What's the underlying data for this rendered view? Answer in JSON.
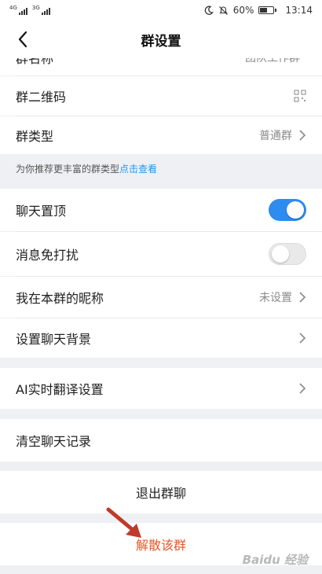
{
  "status_bar": {
    "sim1": "4G",
    "sim2": "3G",
    "battery": "60%",
    "battery_level": 0.6,
    "time": "13:14",
    "icons": [
      "signal-icon",
      "moon-icon",
      "mute-bell-icon",
      "battery-icon"
    ]
  },
  "nav": {
    "title": "群设置",
    "back_icon": "chevron-left-icon"
  },
  "settings": {
    "group_name_label": "群名称",
    "group_name_value": "团队工作群",
    "qr_code_label": "群二维码",
    "qr_code_icon": "qr-code-icon",
    "group_type_label": "群类型",
    "group_type_value": "普通群",
    "tip_text": "为你推荐更丰富的群类型",
    "tip_link": "点击查看",
    "pin_chat_label": "聊天置顶",
    "pin_chat_on": true,
    "mute_label": "消息免打扰",
    "mute_on": false,
    "nickname_label": "我在本群的昵称",
    "nickname_value": "未设置",
    "background_label": "设置聊天背景",
    "translate_label": "AI实时翻译设置",
    "clear_label": "清空聊天记录"
  },
  "actions": {
    "exit_label": "退出群聊",
    "dissolve_label": "解散该群"
  },
  "colors": {
    "accent": "#2d8cf0",
    "link": "#2396f0",
    "danger": "#e8572a",
    "arrow": "#c0392b",
    "background": "#eef0f3"
  },
  "watermark": "Baidu 经验"
}
